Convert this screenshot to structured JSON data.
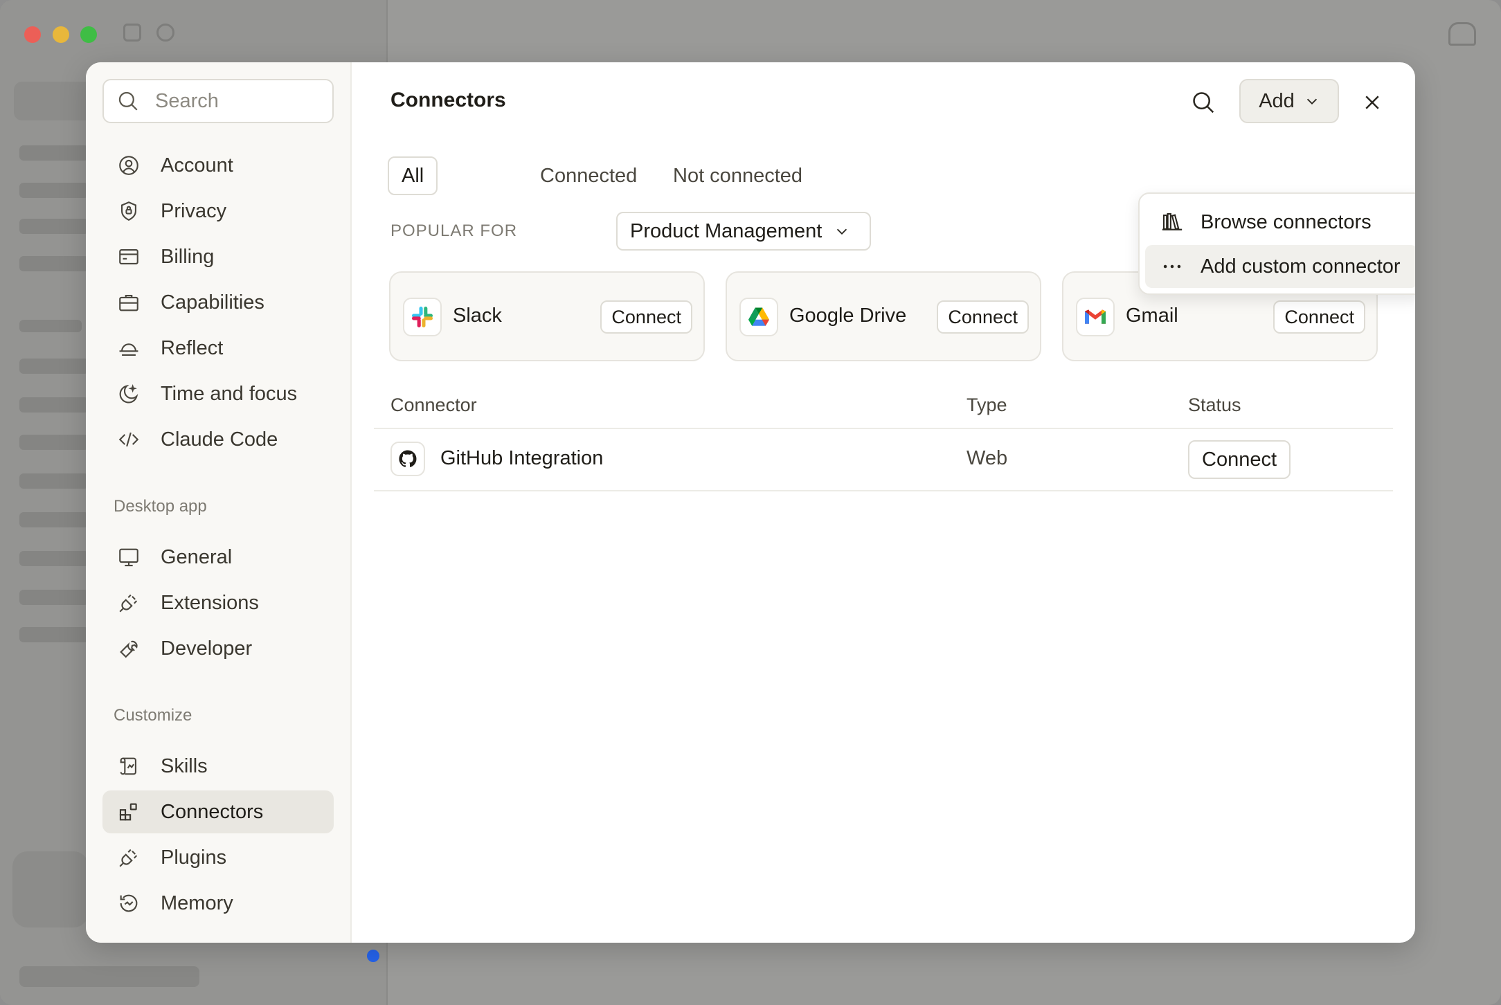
{
  "modal": {
    "search_placeholder": "Search",
    "nav": {
      "items": [
        {
          "label": "Account",
          "icon": "account-icon"
        },
        {
          "label": "Privacy",
          "icon": "shield-icon"
        },
        {
          "label": "Billing",
          "icon": "credit-card-icon"
        },
        {
          "label": "Capabilities",
          "icon": "briefcase-icon"
        },
        {
          "label": "Reflect",
          "icon": "sunrise-icon"
        },
        {
          "label": "Time and focus",
          "icon": "moon-icon"
        },
        {
          "label": "Claude Code",
          "icon": "code-icon"
        }
      ],
      "desktop_section": "Desktop app",
      "desktop_items": [
        {
          "label": "General",
          "icon": "monitor-icon"
        },
        {
          "label": "Extensions",
          "icon": "plug-icon"
        },
        {
          "label": "Developer",
          "icon": "wrench-icon"
        }
      ],
      "customize_section": "Customize",
      "customize_items": [
        {
          "label": "Skills",
          "icon": "scroll-icon"
        },
        {
          "label": "Connectors",
          "icon": "grid-plus-icon",
          "active": true
        },
        {
          "label": "Plugins",
          "icon": "plug-icon"
        },
        {
          "label": "Memory",
          "icon": "history-icon"
        }
      ]
    },
    "header": {
      "title": "Connectors",
      "add_label": "Add"
    },
    "tabs": [
      "All",
      "Connected",
      "Not connected"
    ],
    "popular": {
      "label": "POPULAR FOR",
      "selected": "Product Management"
    },
    "cards": [
      {
        "name": "Slack",
        "button": "Connect",
        "icon": "slack-icon"
      },
      {
        "name": "Google Drive",
        "button": "Connect",
        "icon": "google-drive-icon"
      },
      {
        "name": "Gmail",
        "button": "Connect",
        "icon": "gmail-icon"
      }
    ],
    "table": {
      "headers": [
        "Connector",
        "Type",
        "Status"
      ],
      "rows": [
        {
          "name": "GitHub Integration",
          "type": "Web",
          "status": "Connect",
          "icon": "github-icon"
        }
      ]
    },
    "dropdown": [
      {
        "label": "Browse connectors",
        "icon": "library-icon"
      },
      {
        "label": "Add custom connector",
        "icon": "more-horizontal-icon"
      }
    ]
  },
  "colors": {
    "accent_active_bg": "#e9e7e1",
    "overlay": "#8f8f8f",
    "notification_dot": "#2563eb"
  }
}
